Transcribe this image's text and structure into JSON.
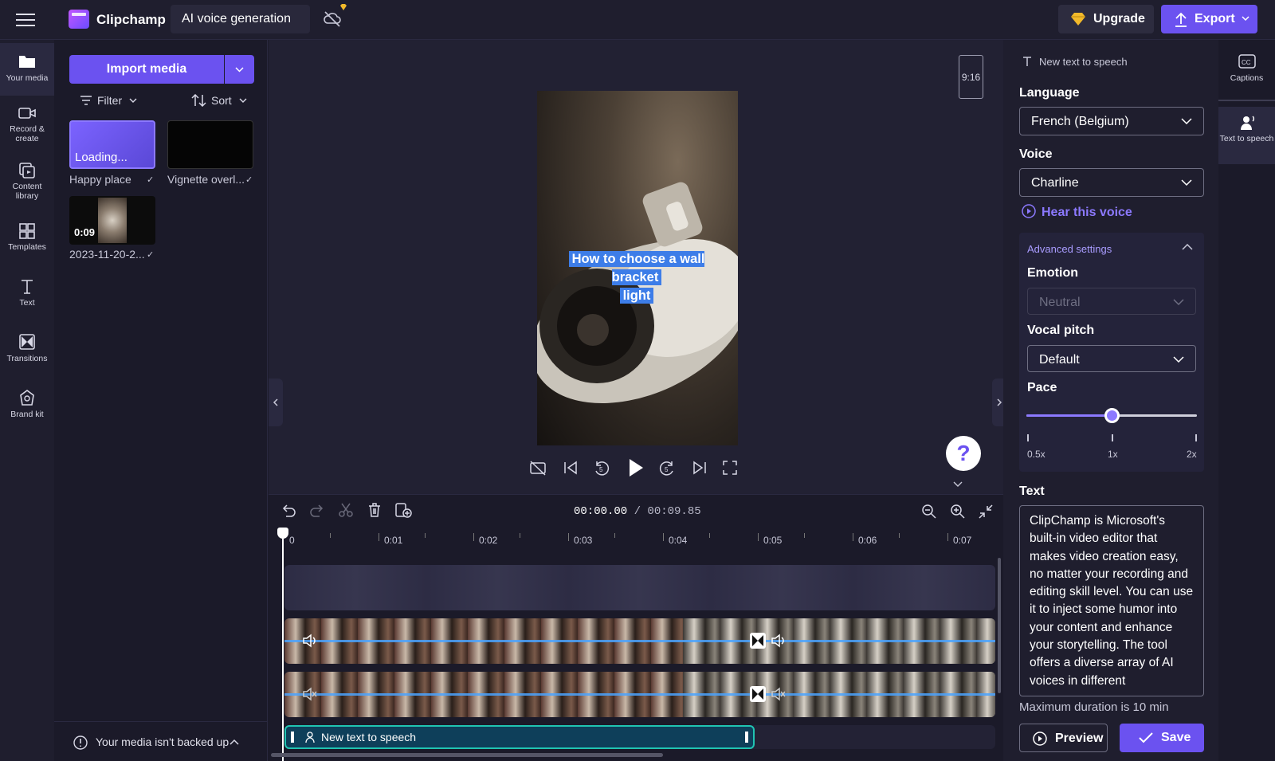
{
  "topbar": {
    "app_name": "Clipchamp",
    "project_name": "AI voice generation",
    "upgrade_label": "Upgrade",
    "export_label": "Export"
  },
  "rail": {
    "items": [
      {
        "label": "Your media"
      },
      {
        "label": "Record & create"
      },
      {
        "label": "Content library"
      },
      {
        "label": "Templates"
      },
      {
        "label": "Text"
      },
      {
        "label": "Transitions"
      },
      {
        "label": "Brand kit"
      }
    ]
  },
  "media": {
    "import_label": "Import media",
    "filter_label": "Filter",
    "sort_label": "Sort",
    "items": [
      {
        "name": "Happy place",
        "overlay": "Loading..."
      },
      {
        "name": "Vignette overl..."
      },
      {
        "name": "2023-11-20-2...",
        "duration": "0:09"
      }
    ],
    "backup_notice": "Your media isn't backed up"
  },
  "preview": {
    "aspect_ratio": "9:16",
    "caption_line1": "How to choose a wall bracket",
    "caption_line2": "light",
    "help_label": "?"
  },
  "timeline": {
    "current_time": "00:00.00",
    "total_time": "/ 00:09.85",
    "ruler_labels": [
      "0",
      "0:01",
      "0:02",
      "0:03",
      "0:04",
      "0:05",
      "0:06",
      "0:07"
    ],
    "tts_clip_label": "New text to speech"
  },
  "tts_panel": {
    "header": "New text to speech",
    "language_label": "Language",
    "language_value": "French (Belgium)",
    "voice_label": "Voice",
    "voice_value": "Charline",
    "hear_voice": "Hear this voice",
    "advanced_label": "Advanced settings",
    "emotion_label": "Emotion",
    "emotion_value": "Neutral",
    "pitch_label": "Vocal pitch",
    "pitch_value": "Default",
    "pace_label": "Pace",
    "pace_value": 0.5,
    "pace_ticks": [
      "0.5x",
      "1x",
      "2x"
    ],
    "text_label": "Text",
    "text_value": "ClipChamp is Microsoft's built-in video editor that makes video creation easy, no matter your recording and editing skill level. You can use it to inject some humor into your content and enhance your storytelling. The tool offers a diverse array of AI voices in different",
    "max_duration": "Maximum duration is 10 min",
    "preview_label": "Preview",
    "save_label": "Save"
  },
  "captions_rail": {
    "items": [
      {
        "label": "Captions"
      },
      {
        "label": "Text to speech"
      }
    ]
  },
  "colors": {
    "accent": "#6b52f0",
    "accent_light": "#8c79ff",
    "tts_clip_border": "#20c4b2",
    "caption_bg": "#3d7de8"
  }
}
